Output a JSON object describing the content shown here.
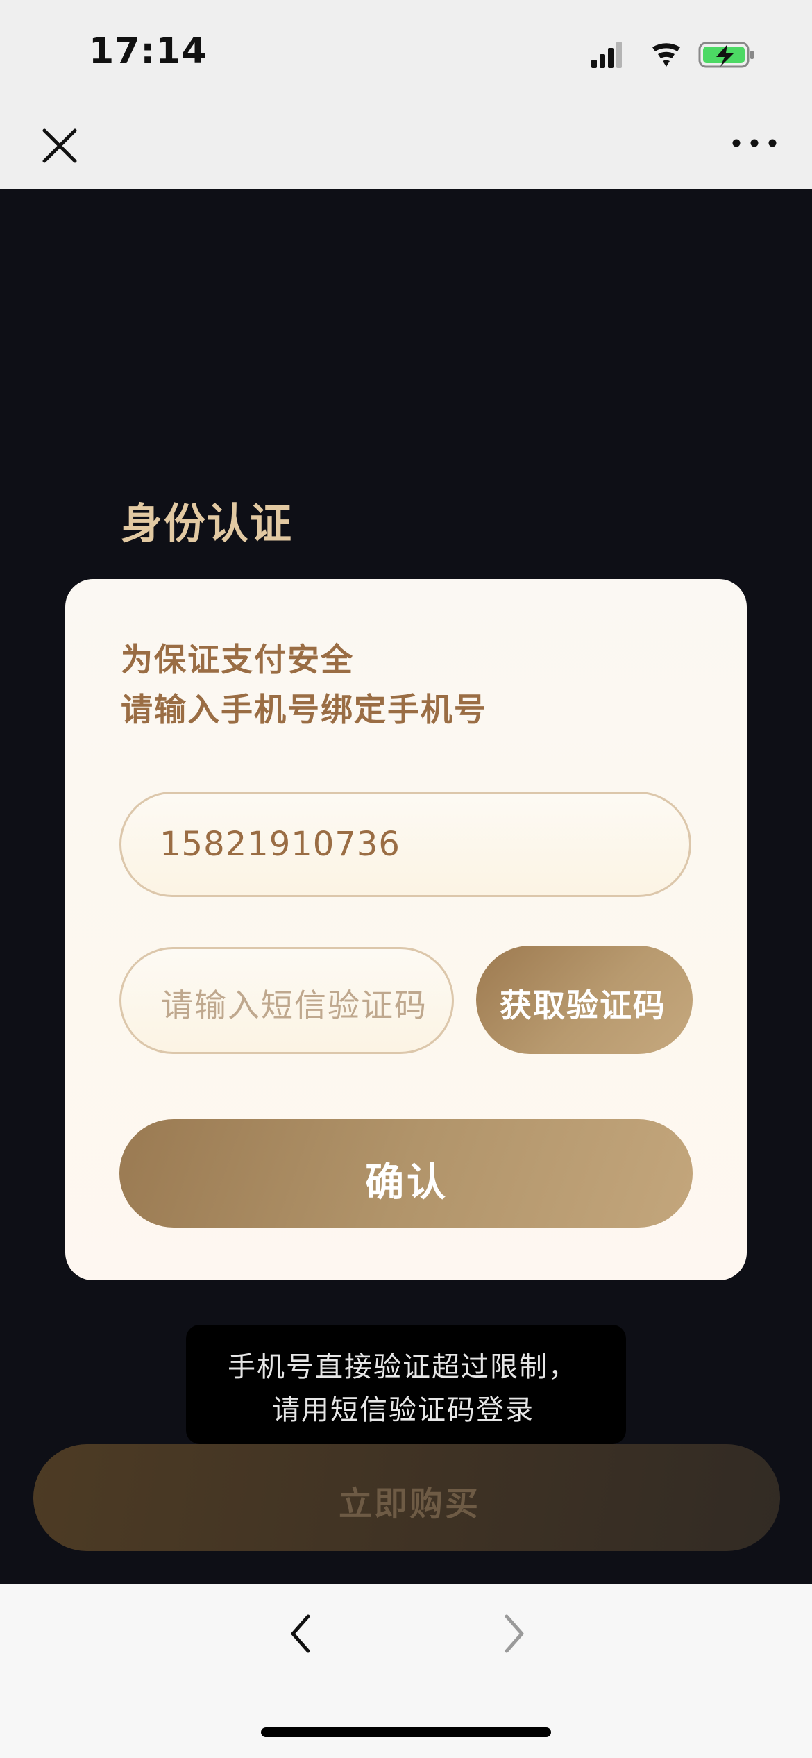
{
  "status_bar": {
    "time": "17:14",
    "icons": [
      "cellular-signal-icon",
      "wifi-icon",
      "battery-charging-icon"
    ],
    "battery_color": "#4cd964"
  },
  "nav": {
    "close_icon": "close-icon",
    "more_icon": "more-icon"
  },
  "page": {
    "title": "身份认证"
  },
  "card": {
    "subtitle_line1": "为保证支付安全",
    "subtitle_line2": "请输入手机号绑定手机号",
    "phone_value": "15821910736",
    "code_placeholder": "请输入短信验证码",
    "get_code_label": "获取验证码",
    "confirm_label": "确认"
  },
  "buy_button": {
    "label": "立即购买"
  },
  "toast": {
    "line1": "手机号直接验证超过限制，",
    "line2": "请用短信验证码登录"
  },
  "bottom_nav": {
    "back_icon": "chevron-left-icon",
    "forward_icon": "chevron-right-icon"
  },
  "colors": {
    "accent_gold": "#b1946a",
    "title_gold": "#e2c9a2",
    "background": "#0e0f16"
  }
}
